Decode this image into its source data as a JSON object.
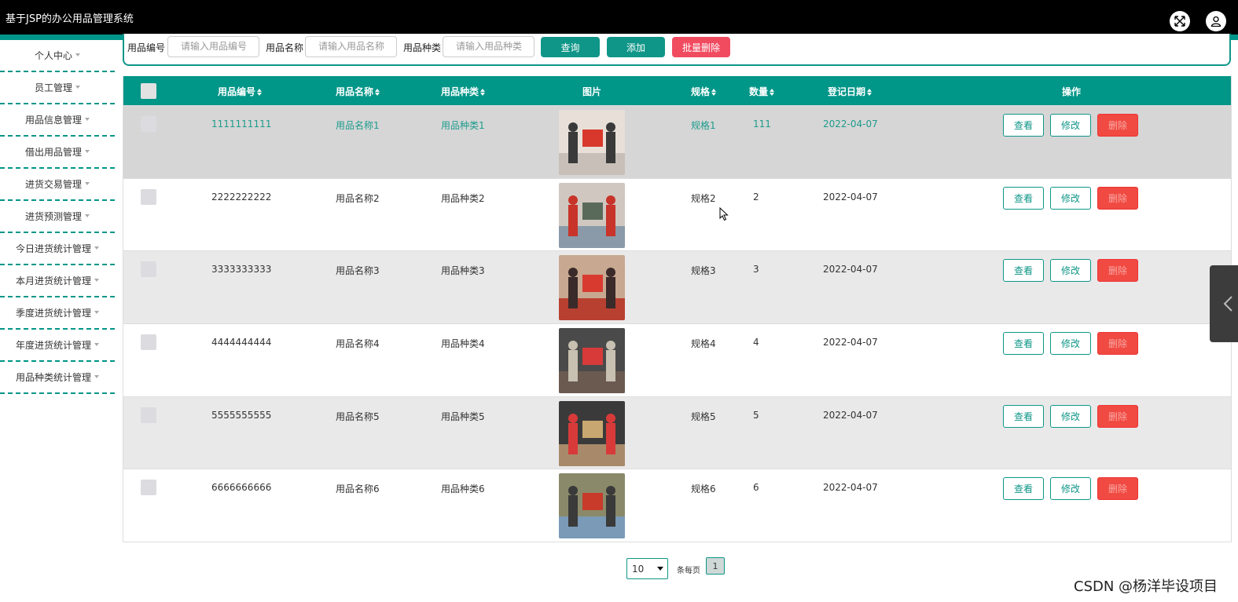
{
  "header": {
    "title": "基于JSP的办公用品管理系统",
    "fullscreen_icon": "expand-icon",
    "user_icon": "user-icon",
    "bg_color": "#000000",
    "accent_color": "#00968a"
  },
  "sidebar": {
    "items": [
      {
        "label": "个人中心"
      },
      {
        "label": "员工管理"
      },
      {
        "label": "用品信息管理"
      },
      {
        "label": "借出用品管理"
      },
      {
        "label": "进货交易管理"
      },
      {
        "label": "进货预测管理"
      },
      {
        "label": "今日进货统计管理"
      },
      {
        "label": "本月进货统计管理"
      },
      {
        "label": "季度进货统计管理"
      },
      {
        "label": "年度进货统计管理"
      },
      {
        "label": "用品种类统计管理"
      }
    ]
  },
  "search": {
    "code_label": "用品编号",
    "code_placeholder": "请输入用品编号",
    "name_label": "用品名称",
    "name_placeholder": "请输入用品名称",
    "type_label": "用品种类",
    "type_placeholder": "请输入用品种类",
    "query_button": "查询",
    "add_button": "添加",
    "batch_delete_button": "批量删除"
  },
  "table": {
    "headers": {
      "code": "用品编号",
      "name": "用品名称",
      "type": "用品种类",
      "image": "图片",
      "spec": "规格",
      "qty": "数量",
      "date": "登记日期",
      "actions": "操作"
    },
    "rows": [
      {
        "code": "1111111111",
        "name": "用品名称1",
        "type": "用品种类1",
        "spec": "规格1",
        "qty": "111",
        "date": "2022-04-07"
      },
      {
        "code": "2222222222",
        "name": "用品名称2",
        "type": "用品种类2",
        "spec": "规格2",
        "qty": "2",
        "date": "2022-04-07"
      },
      {
        "code": "3333333333",
        "name": "用品名称3",
        "type": "用品种类3",
        "spec": "规格3",
        "qty": "3",
        "date": "2022-04-07"
      },
      {
        "code": "4444444444",
        "name": "用品名称4",
        "type": "用品种类4",
        "spec": "规格4",
        "qty": "4",
        "date": "2022-04-07"
      },
      {
        "code": "5555555555",
        "name": "用品名称5",
        "type": "用品种类5",
        "spec": "规格5",
        "qty": "5",
        "date": "2022-04-07"
      },
      {
        "code": "6666666666",
        "name": "用品名称6",
        "type": "用品种类6",
        "spec": "规格6",
        "qty": "6",
        "date": "2022-04-07"
      }
    ],
    "view_label": "查看",
    "edit_label": "修改",
    "delete_label": "删除"
  },
  "pagination": {
    "page_size": "10",
    "per_page_label": "条每页",
    "current_page": "1"
  },
  "watermark": "CSDN @杨洋毕设项目"
}
